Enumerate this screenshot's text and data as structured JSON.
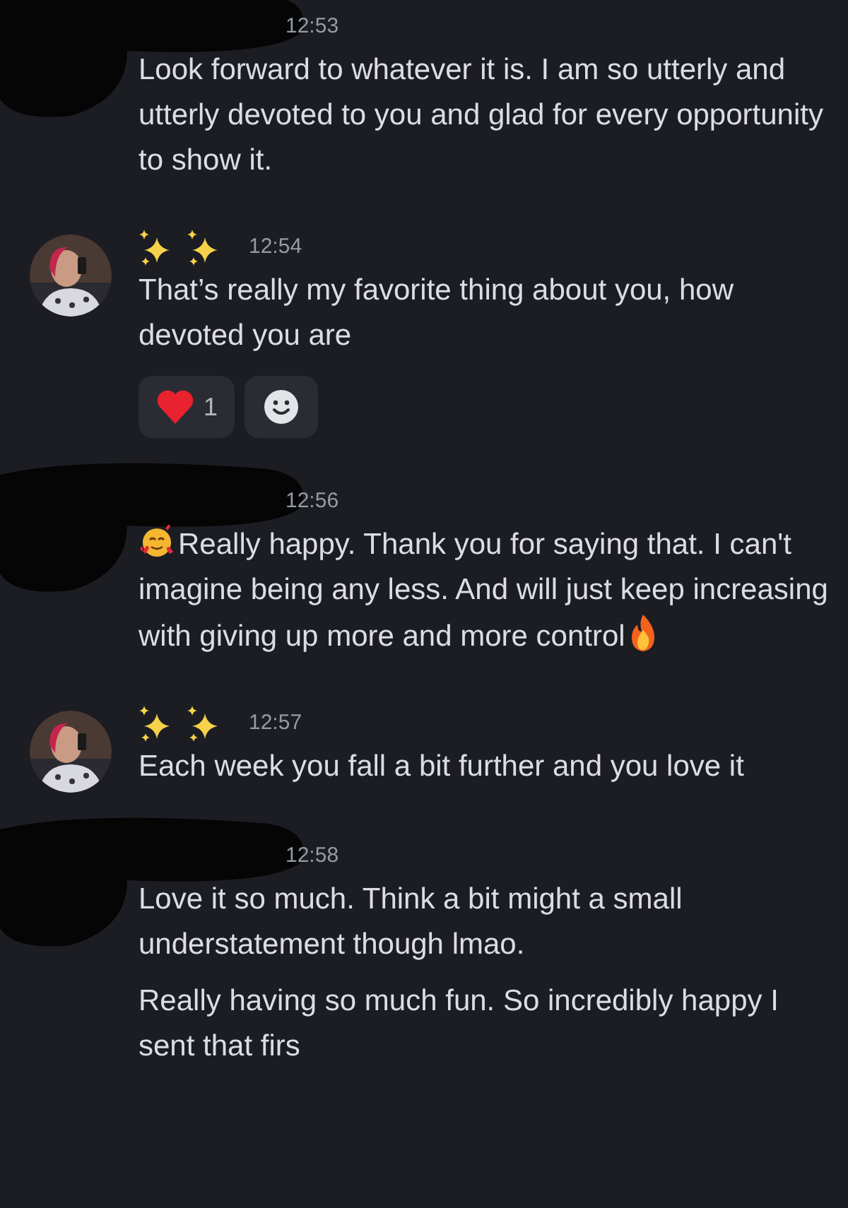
{
  "messages": [
    {
      "author": {
        "kind": "redacted"
      },
      "time": "12:53",
      "paragraphs": [
        [
          {
            "kind": "text",
            "text": "Look forward to whatever it is. I am so utterly and utterly devoted to you and glad for every opportunity to show it."
          }
        ]
      ]
    },
    {
      "author": {
        "kind": "sparkles"
      },
      "time": "12:54",
      "paragraphs": [
        [
          {
            "kind": "text",
            "text": "That’s really my favorite thing about you, how devoted you are"
          }
        ]
      ],
      "reactions": [
        {
          "kind": "heart",
          "count": "1"
        },
        {
          "kind": "add"
        }
      ]
    },
    {
      "author": {
        "kind": "redacted"
      },
      "time": "12:56",
      "paragraphs": [
        [
          {
            "kind": "blush"
          },
          {
            "kind": "text",
            "text": "Really happy. Thank you for saying that. I can't imagine being any less. And will just keep increasing with giving up more and more control"
          },
          {
            "kind": "fire"
          }
        ]
      ]
    },
    {
      "author": {
        "kind": "sparkles"
      },
      "time": "12:57",
      "paragraphs": [
        [
          {
            "kind": "text",
            "text": "Each week you fall a bit further and you love it"
          }
        ]
      ]
    },
    {
      "author": {
        "kind": "redacted"
      },
      "time": "12:58",
      "paragraphs": [
        [
          {
            "kind": "text",
            "text": "Love it so much. Think a bit might a small understatement though lmao."
          }
        ],
        [
          {
            "kind": "text",
            "text": "Really having so much fun. So incredibly happy I sent that firs"
          }
        ]
      ]
    }
  ]
}
